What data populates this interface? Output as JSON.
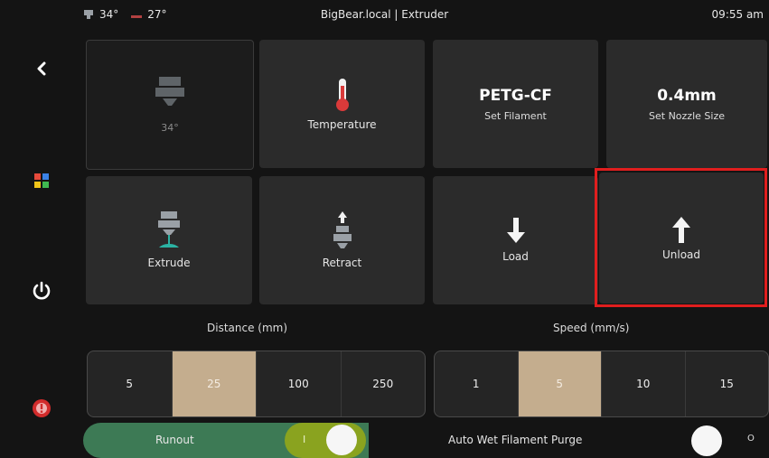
{
  "topbar": {
    "extruder_temp": "34°",
    "bed_temp": "27°",
    "title": "BigBear.local | Extruder",
    "clock": "09:55 am"
  },
  "sidebar": {
    "back_icon": "chevron-left-icon",
    "menu_icon": "grid-icon",
    "power_icon": "power-icon",
    "alert_icon": "alert-icon"
  },
  "tiles": {
    "current_extruder": {
      "temp": "34°"
    },
    "temperature": {
      "label": "Temperature"
    },
    "filament": {
      "value": "PETG-CF",
      "label": "Set Filament"
    },
    "nozzle": {
      "value": "0.4mm",
      "label": "Set Nozzle Size"
    },
    "extrude": {
      "label": "Extrude"
    },
    "retract": {
      "label": "Retract"
    },
    "load": {
      "label": "Load"
    },
    "unload": {
      "label": "Unload"
    }
  },
  "distance": {
    "label": "Distance (mm)",
    "options": [
      "5",
      "25",
      "100",
      "250"
    ],
    "selected": "25"
  },
  "speed": {
    "label": "Speed (mm/s)",
    "options": [
      "1",
      "5",
      "10",
      "15"
    ],
    "selected": "5"
  },
  "runout": {
    "label": "Runout",
    "state": "on",
    "toggle_mark": "I"
  },
  "auto_wet_purge": {
    "label": "Auto Wet Filament Purge",
    "state": "off",
    "toggle_mark": "O"
  },
  "colors": {
    "background": "#141414",
    "tile": "#2b2b2b",
    "selected": "#c4ad8e",
    "runout_green": "#3d7a55",
    "toggle_on": "#8aa31f",
    "highlight": "#e01e1e"
  }
}
